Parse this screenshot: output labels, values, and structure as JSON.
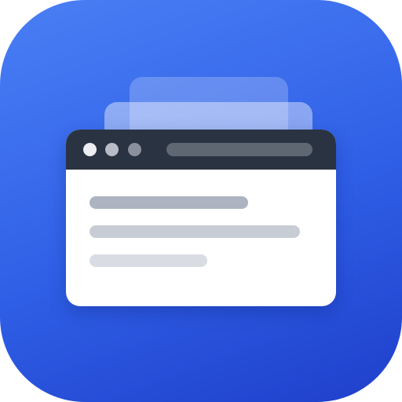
{
  "icon": {
    "name": "browser-app-icon",
    "colors": {
      "gradient_start": "#4a7ff5",
      "gradient_mid": "#2f5fe6",
      "gradient_end": "#1f3fcb",
      "title_bar": "#2a3342",
      "window_body": "#ffffff",
      "address_bar": "#5f6773"
    },
    "window_dots": [
      {
        "color": "#eceef1"
      },
      {
        "color": "#b8bcc6"
      },
      {
        "color": "#8a909c"
      }
    ],
    "content_line_colors": [
      "#adb3c0",
      "#c8ccd4",
      "#d9dce2"
    ]
  }
}
